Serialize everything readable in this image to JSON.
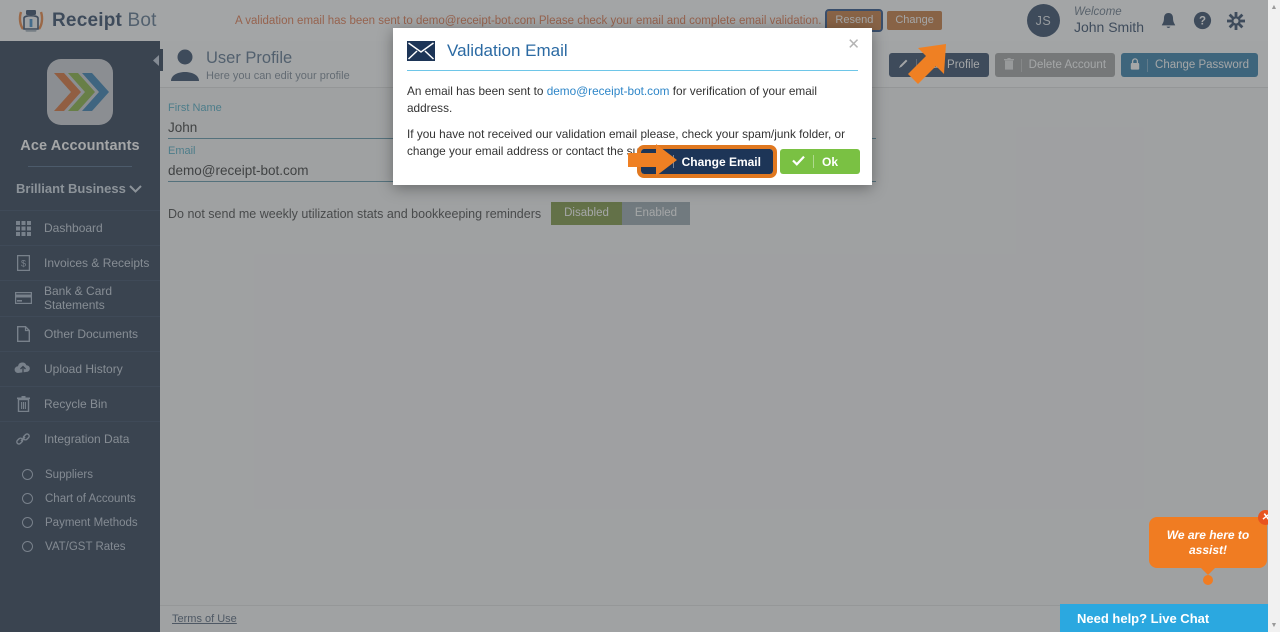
{
  "topbar": {
    "brand_bold": "Receipt",
    "brand_light": " Bot",
    "validation_message_pre": "A validation email has been sent to ",
    "validation_email": "demo@receipt-bot.com",
    "validation_message_post": " Please check your email and complete email validation.",
    "resend_label": "Resend",
    "change_label": "Change",
    "avatar_initials": "JS",
    "welcome_label": "Welcome",
    "user_name": "John Smith",
    "bell_icon": "bell-icon",
    "help_icon": "help-circle-icon",
    "gear_icon": "gear-icon",
    "accent_orange": "#e06a3b",
    "brand_navy": "#1d3557"
  },
  "sidebar": {
    "company": "Ace Accountants",
    "business_selector": "Brilliant Business",
    "items": [
      {
        "label": "Dashboard",
        "icon": "grid-icon"
      },
      {
        "label": "Invoices & Receipts",
        "icon": "receipt-icon"
      },
      {
        "label": "Bank & Card Statements",
        "icon": "credit-card-icon"
      },
      {
        "label": "Other Documents",
        "icon": "document-icon"
      },
      {
        "label": "Upload History",
        "icon": "cloud-upload-icon"
      },
      {
        "label": "Recycle Bin",
        "icon": "trash-icon"
      },
      {
        "label": "Integration Data",
        "icon": "link-icon"
      }
    ],
    "sub_items": [
      {
        "label": "Suppliers",
        "icon": "circle-icon"
      },
      {
        "label": "Chart of Accounts",
        "icon": "circle-icon"
      },
      {
        "label": "Payment Methods",
        "icon": "circle-icon"
      },
      {
        "label": "VAT/GST Rates",
        "icon": "circle-icon"
      }
    ],
    "collapse_icon": "chevron-left-icon",
    "bg_color": "#16263f"
  },
  "page": {
    "title": "User Profile",
    "subtitle": "Here you can edit your profile",
    "profile_icon": "user-icon",
    "actions": [
      {
        "label": "Edit Profile",
        "icon": "pencil-icon",
        "style": "dark"
      },
      {
        "label": "Delete Account",
        "icon": "trash-icon",
        "style": "grey"
      },
      {
        "label": "Change Password",
        "icon": "lock-icon",
        "style": "teal"
      }
    ],
    "fields": [
      {
        "label": "First Name",
        "value": "John"
      },
      {
        "label": "Email",
        "value": "demo@receipt-bot.com"
      }
    ],
    "toggle_label": "Do not send me weekly utilization stats and bookkeeping reminders",
    "toggle_options": [
      {
        "label": "Disabled",
        "selected": true
      },
      {
        "label": "Enabled",
        "selected": false
      }
    ],
    "footer_link": "Terms of Use"
  },
  "modal": {
    "title": "Validation Email",
    "envelope_icon": "envelope-icon",
    "close_icon": "close-icon",
    "paragraph1_pre": "An email has been sent to ",
    "paragraph1_link": "demo@receipt-bot.com",
    "paragraph1_post": " for verification of your email address.",
    "paragraph2": "If you have not received our validation email please, check your spam/junk folder, or change your email address or contact the support team.",
    "change_email_label": "Change Email",
    "change_email_icon": "envelope-small-icon",
    "ok_label": "Ok",
    "ok_icon": "check-icon",
    "highlight_color": "#e07820",
    "ok_color": "#7ac143"
  },
  "chat": {
    "bubble_text": "We are here to assist!",
    "bubble_close_icon": "close-icon",
    "bar_label": "Need help? Live Chat",
    "bar_color": "#2ba8e0",
    "bubble_color": "#f07c22"
  },
  "annotations": {
    "arrow_topbar": "arrow-pointing-to-resend",
    "arrow_modal": "arrow-pointing-to-change-email",
    "arrow_color": "#ef8023",
    "highlight_color": "#123c7a"
  }
}
